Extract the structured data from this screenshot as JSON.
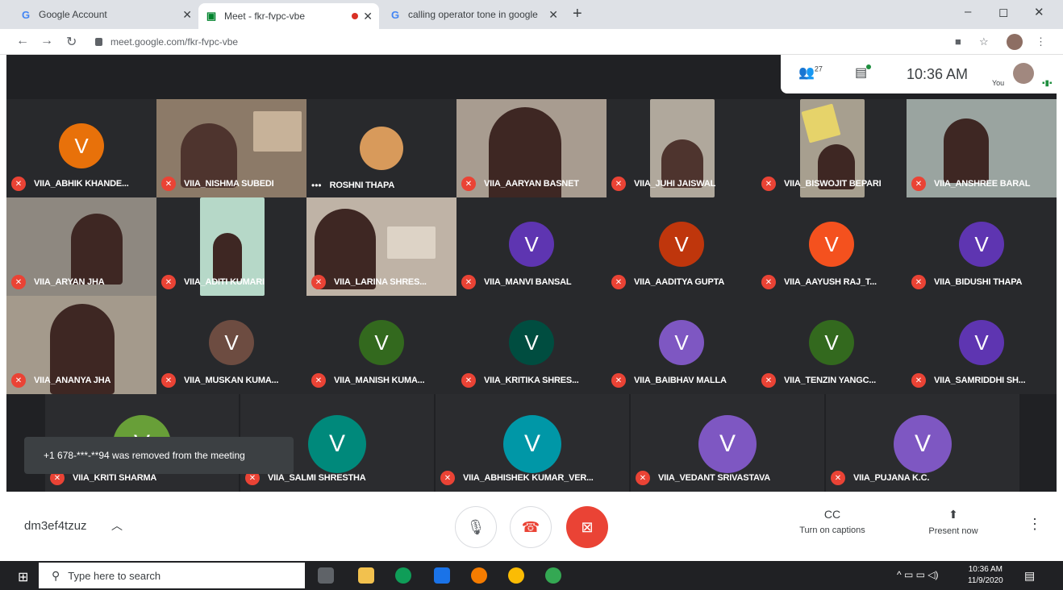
{
  "browser": {
    "tabs": [
      {
        "title": "Google Account",
        "icon": "google-g-icon"
      },
      {
        "title": "Meet - fkr-fvpc-vbe",
        "icon": "meet-icon",
        "recording": true
      },
      {
        "title": "calling operator tone in google",
        "icon": "google-g-icon"
      }
    ],
    "new_tab": "+",
    "address": "meet.google.com/fkr-fvpc-vbe",
    "window_controls": {
      "minimize": "–",
      "maximize": "◻",
      "close": "✕"
    }
  },
  "meet_top": {
    "participant_count": "27",
    "clock": "10:36 AM",
    "you_label": "You"
  },
  "tiles_rows": [
    [
      {
        "name": "VIIA_ABHIK KHANDE...",
        "avatar": "V",
        "color": "#e8710a"
      },
      {
        "name": "VIIA_NISHMA SUBEDI",
        "video": true
      },
      {
        "name": "ROSHNI THAPA",
        "video": true,
        "dots": true
      },
      {
        "name": "VIIA_AARYAN BASNET",
        "video": true
      },
      {
        "name": "VIIA_JUHI JAISWAL",
        "video": true
      },
      {
        "name": "VIIA_BISWOJIT BEPARI",
        "video": true
      },
      {
        "name": "VIIA_ANSHREE BARAL",
        "video": true
      }
    ],
    [
      {
        "name": "VIIA_ARYAN JHA",
        "video": true
      },
      {
        "name": "VIIA_ADITI KUMARI",
        "video": true
      },
      {
        "name": "VIIA_LARINA SHRES...",
        "video": true
      },
      {
        "name": "VIIA_MANVI BANSAL",
        "avatar": "V",
        "color": "#5e35b1"
      },
      {
        "name": "VIIA_AADITYA GUPTA",
        "avatar": "V",
        "color": "#bf360c"
      },
      {
        "name": "VIIA_AAYUSH RAJ_T...",
        "avatar": "V",
        "color": "#f4511e"
      },
      {
        "name": "VIIA_BIDUSHI THAPA",
        "avatar": "V",
        "color": "#5e35b1"
      }
    ],
    [
      {
        "name": "VIIA_ANANYA JHA",
        "video": true
      },
      {
        "name": "VIIA_MUSKAN KUMA...",
        "avatar": "V",
        "color": "#6d4c41"
      },
      {
        "name": "VIIA_MANISH KUMA...",
        "avatar": "V",
        "color": "#33691e"
      },
      {
        "name": "VIIA_KRITIKA SHRES...",
        "avatar": "V",
        "color": "#004d40"
      },
      {
        "name": "VIIA_BAIBHAV MALLA",
        "avatar": "V",
        "color": "#7e57c2"
      },
      {
        "name": "VIIA_TENZIN YANGC...",
        "avatar": "V",
        "color": "#33691e"
      },
      {
        "name": "VIIA_SAMRIDDHI SH...",
        "avatar": "V",
        "color": "#5e35b1"
      }
    ],
    [
      {
        "name": "VIIA_KRITI SHARMA",
        "avatar": "V",
        "color": "#689f38"
      },
      {
        "name": "VIIA_SALMI SHRESTHA",
        "avatar": "V",
        "color": "#00897b"
      },
      {
        "name": "VIIA_ABHISHEK KUMAR_VER...",
        "avatar": "V",
        "color": "#0097a7"
      },
      {
        "name": "VIIA_VEDANT SRIVASTAVA",
        "avatar": "V",
        "color": "#7e57c2"
      },
      {
        "name": "VIIA_PUJANA K.C.",
        "avatar": "V",
        "color": "#7e57c2"
      }
    ]
  ],
  "toast": "+1 678-***-**94 was removed from the meeting",
  "controls": {
    "meeting_code": "dm3ef4tzuz",
    "captions_label": "Turn on captions",
    "present_label": "Present now",
    "captions_icon_text": "CC"
  },
  "taskbar": {
    "search_placeholder": "Type here to search",
    "time": "10:36 AM",
    "date": "11/9/2020"
  }
}
